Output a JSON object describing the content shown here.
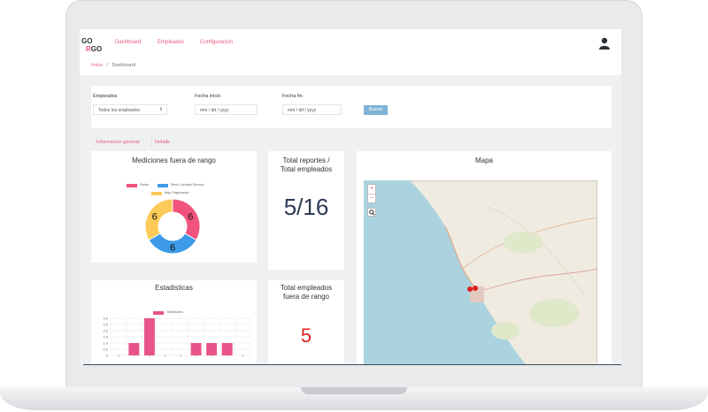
{
  "nav": {
    "logo": "GORGO",
    "items": [
      "Dashboard",
      "Empleados",
      "Configuracion"
    ],
    "user_icon": "user-icon"
  },
  "breadcrumb": {
    "home": "Inicio",
    "separator": "/",
    "current": "Dashboard"
  },
  "filters": {
    "empleados_label": "Empleados",
    "empleados_value": "Todos los empleados",
    "fecha_inicio_label": "Fecha inicio",
    "fecha_inicio_placeholder": "mm / dd / yyyy",
    "fecha_fin_label": "Fecha fin",
    "fecha_fin_placeholder": "mm / dd / yyyy",
    "buscar_label": "Buscar"
  },
  "tabs": [
    "Informacion general",
    "Detalle"
  ],
  "cards": {
    "mediciones": {
      "title": "Mediciones fuera de rango",
      "legend": [
        {
          "name": "Fiebre",
          "color": "#f0537d"
        },
        {
          "name": "Ritmo Cardiaco Elevado",
          "color": "#3d9be9"
        },
        {
          "name": "Baja Oxigenacion",
          "color": "#fcca58"
        }
      ]
    },
    "total_reportes": {
      "title_line1": "Total reportes /",
      "title_line2": "Total empleados",
      "value": "5/16"
    },
    "mapa": {
      "title": "Mapa",
      "zoom_in": "+",
      "zoom_out": "−"
    },
    "estadisticas": {
      "title": "Estadisticas",
      "legend": "Mediciones"
    },
    "total_fuera": {
      "title_line1": "Total empleados",
      "title_line2": "fuera de rango",
      "value": "5"
    }
  },
  "chart_data": [
    {
      "type": "pie",
      "title": "Mediciones fuera de rango",
      "categories": [
        "Fiebre",
        "Ritmo Cardiaco Elevado",
        "Baja Oxigenacion"
      ],
      "values": [
        6,
        6,
        6
      ],
      "colors": [
        "#f0537d",
        "#3d9be9",
        "#fcca58"
      ],
      "donut": true
    },
    {
      "type": "bar",
      "title": "Estadisticas",
      "series": [
        {
          "name": "Mediciones",
          "values": [
            0,
            1,
            3,
            0,
            0,
            1,
            1,
            1,
            0
          ]
        }
      ],
      "yticks": [
        "0",
        "0.5",
        "1.0",
        "1.5",
        "2.0",
        "2.5",
        "3.0"
      ],
      "ylim": [
        0,
        3
      ],
      "color": "#e8548a"
    }
  ]
}
